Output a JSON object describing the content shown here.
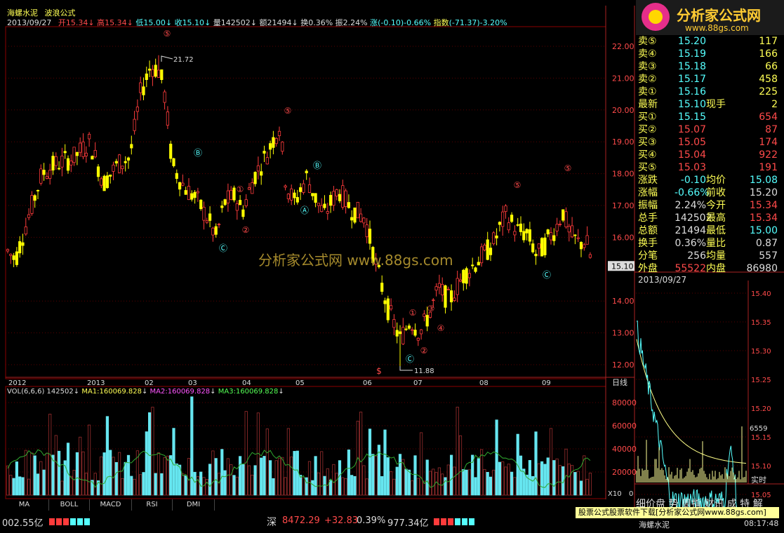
{
  "header": {
    "stock_name": "海螺水泥",
    "indicator_name": "波浪公式",
    "date": "2013/09/27",
    "open_label": "开",
    "open": "15.34",
    "high_label": "高",
    "high": "15.34",
    "low_label": "低",
    "low": "15.00",
    "close_label": "收",
    "close": "15.10",
    "volume_label": "量",
    "volume": "142502",
    "amount_label": "额",
    "amount": "21494",
    "turnover_label": "换",
    "turnover": "0.36%",
    "amplitude_label": "振",
    "amplitude": "2.24%",
    "change_label": "涨",
    "change": "(-0.10)-0.66%",
    "index_label": "指数",
    "index": "(-71.37)-3.20%"
  },
  "price_axis": [
    "22.00",
    "21.00",
    "20.00",
    "19.00",
    "18.00",
    "17.00",
    "16.00",
    "15.10",
    "14.00",
    "13.00",
    "12.00"
  ],
  "time_axis": [
    "2012",
    "2013",
    "02",
    "03",
    "04",
    "05",
    "06",
    "07",
    "08",
    "09"
  ],
  "period_label": "日线",
  "annotations": {
    "high_mark": "21.72",
    "low_mark": "11.88",
    "wave5_a": "⑤",
    "waveB_a": "Ⓑ",
    "waveC_a": "Ⓒ",
    "wave1_a": "①",
    "wave2_a": "②",
    "wave5_b": "⑤",
    "waveA_b": "Ⓐ",
    "waveB_b": "Ⓑ",
    "waveC_b": "Ⓒ",
    "wave1_c": "①",
    "wave2_c": "②",
    "wave3_c": "③",
    "wave4_c": "④",
    "wave5_c": "⑤",
    "wave5_d": "⑤",
    "waveC_d": "Ⓒ",
    "dollar": "$"
  },
  "watermark": "分析家公式网 www.88gs.com",
  "volume_header": {
    "label": "VOL(6,6,6)",
    "vol": "142502",
    "ma1": "MA1:160069.828",
    "ma2": "MA2:160069.828",
    "ma3": "MA3:160069.828"
  },
  "volume_axis": [
    "80000",
    "60000",
    "40000",
    "20000"
  ],
  "volume_unit": "X10",
  "volume_zero": "0",
  "indicator_tabs": [
    "MA",
    "BOLL",
    "MACD",
    "RSI",
    "DMI"
  ],
  "quote": {
    "sell": [
      {
        "label": "卖⑤",
        "price": "15.20",
        "vol": "117"
      },
      {
        "label": "卖④",
        "price": "15.19",
        "vol": "166"
      },
      {
        "label": "卖③",
        "price": "15.18",
        "vol": "66"
      },
      {
        "label": "卖②",
        "price": "15.17",
        "vol": "458"
      },
      {
        "label": "卖①",
        "price": "15.16",
        "vol": "225"
      }
    ],
    "latest_label": "最新",
    "latest": "15.10",
    "current_hand_label": "现手",
    "current_hand": "2",
    "buy": [
      {
        "label": "买①",
        "price": "15.15",
        "vol": "654"
      },
      {
        "label": "买②",
        "price": "15.07",
        "vol": "87"
      },
      {
        "label": "买③",
        "price": "15.05",
        "vol": "174"
      },
      {
        "label": "买④",
        "price": "15.04",
        "vol": "922"
      },
      {
        "label": "买⑤",
        "price": "15.03",
        "vol": "191"
      }
    ],
    "stats": [
      {
        "l1": "涨跌",
        "v1": "-0.10",
        "l2": "均价",
        "v2": "15.08"
      },
      {
        "l1": "涨幅",
        "v1": "-0.66%",
        "l2": "前收",
        "v2": "15.20"
      },
      {
        "l1": "振幅",
        "v1": "2.24%",
        "l2": "今开",
        "v2": "15.34"
      },
      {
        "l1": "总手",
        "v1": "142502",
        "l2": "最高",
        "v2": "15.34"
      },
      {
        "l1": "总额",
        "v1": "21494",
        "l2": "最低",
        "v2": "15.00"
      },
      {
        "l1": "换手",
        "v1": "0.36%",
        "l2": "量比",
        "v2": "0.87"
      },
      {
        "l1": "分笔",
        "v1": "256",
        "l2": "均量",
        "v2": "557"
      },
      {
        "l1": "外盘",
        "v1": "55522",
        "l2": "内盘",
        "v2": "86980"
      }
    ]
  },
  "intraday": {
    "date": "2013/09/27",
    "axis": [
      "15.40",
      "15.35",
      "15.30",
      "15.25",
      "15.20",
      "15.15",
      "15.10",
      "15.05"
    ],
    "vol_max": "6559",
    "realtime_label": "实时"
  },
  "bottom_tabs": "细价盘 势 周指 财讯 成 特 解",
  "status": {
    "left_amount": "002.55亿",
    "market": "深",
    "index_value": "8472.29",
    "index_change": "+32.83",
    "index_pct": "0.39%",
    "turnover": "977.34亿",
    "stock": "海螺水泥",
    "time": "08:17:48"
  },
  "banner": "股票公式股票软件下载[分析家公式网www.88gs.com]",
  "logo_text": "分析家公式网",
  "logo_url": "www.88gs.com",
  "colors": {
    "up": "#ff3b3b",
    "down_candle": "#ffff00",
    "vol_up": "#9a2e2e",
    "vol_down": "#66e6f0",
    "ma_line": "#2fa82f"
  }
}
